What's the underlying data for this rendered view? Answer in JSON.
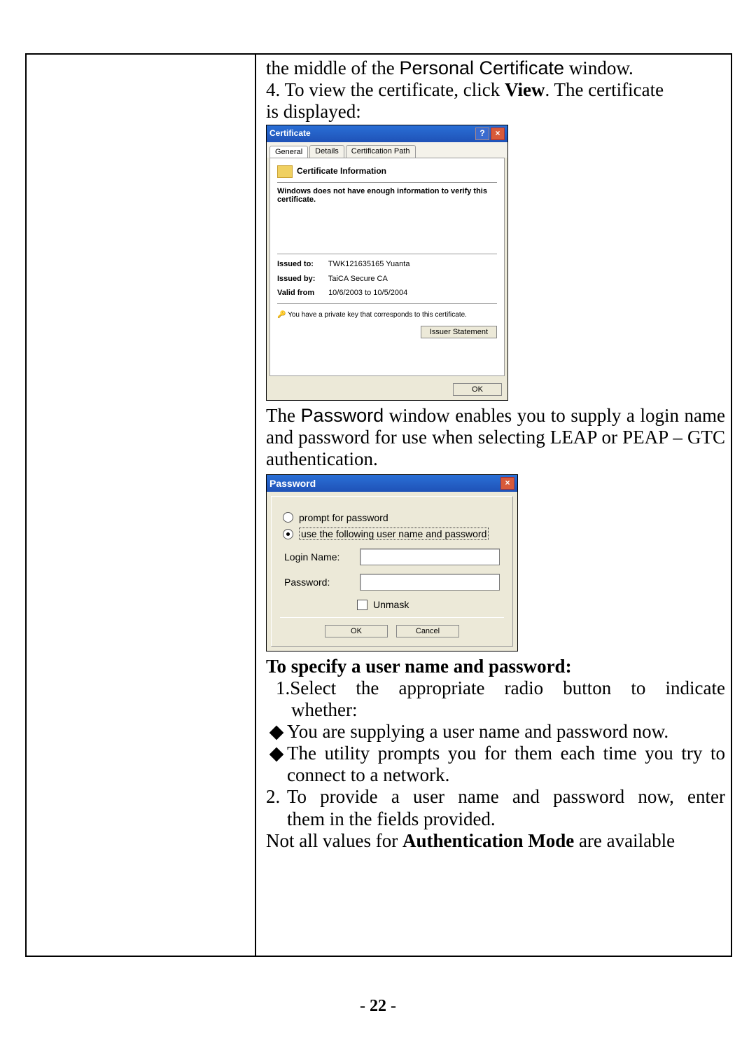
{
  "doc": {
    "line_intro_a": "the middle of the ",
    "line_intro_b": "Personal Certificate",
    "line_intro_c": " window.",
    "step4_a": "4. To view the certificate, click ",
    "step4_b": "View",
    "step4_c": ". The certificate",
    "step4_d": "is displayed:",
    "para2_a": "The ",
    "para2_b": "Password",
    "para2_c": " window enables you to supply a login name and password for use when selecting LEAP or PEAP – GTC authentication.",
    "to_specify": "To specify a user name and password:",
    "s1": "1.Select the appropriate radio button to indicate whether:",
    "b1": "You are supplying a user name and password now.",
    "b2": "The utility prompts you for them each time you try to connect to a network.",
    "s2": "2. To provide a user name and password now, enter them in the fields provided.",
    "note_a": "Not all values for ",
    "note_b": "Authentication Mode",
    "note_c": " are available",
    "page": "- 22 -"
  },
  "cert": {
    "title": "Certificate",
    "tab_general": "General",
    "tab_details": "Details",
    "tab_path": "Certification Path",
    "head": "Certificate Information",
    "msg": "Windows does not have enough information to verify this certificate.",
    "issued_to_l": "Issued to:",
    "issued_to_v": "TWK121635165 Yuanta",
    "issued_by_l": "Issued by:",
    "issued_by_v": "TaiCA Secure CA",
    "valid_l": "Valid from",
    "valid_v": "10/6/2003 to 10/5/2004",
    "pk": "You have a private key that corresponds to this certificate.",
    "issuer_btn": "Issuer Statement",
    "ok": "OK"
  },
  "pwd": {
    "title": "Password",
    "r1": "prompt for password",
    "r2": "use the following user name and password",
    "login": "Login Name:",
    "password": "Password:",
    "unmask": "Unmask",
    "ok": "OK",
    "cancel": "Cancel"
  }
}
